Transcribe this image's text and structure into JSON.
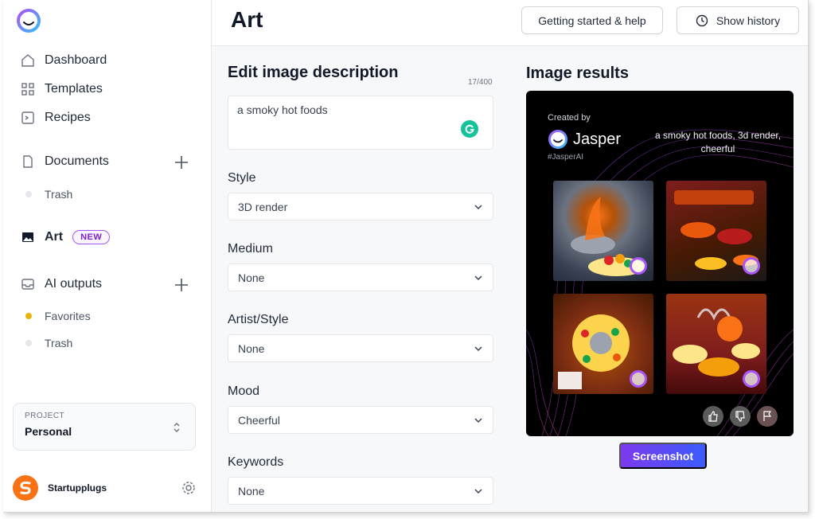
{
  "sidebar": {
    "nav": [
      {
        "label": "Dashboard",
        "icon": "home-icon"
      },
      {
        "label": "Templates",
        "icon": "grid-icon"
      },
      {
        "label": "Recipes",
        "icon": "terminal-icon"
      }
    ],
    "documents": {
      "label": "Documents",
      "items": [
        {
          "label": "Trash"
        }
      ]
    },
    "art": {
      "label": "Art",
      "badge": "NEW"
    },
    "ai_outputs": {
      "label": "AI outputs",
      "items": [
        {
          "label": "Favorites"
        },
        {
          "label": "Trash"
        }
      ]
    },
    "project": {
      "label": "PROJECT",
      "value": "Personal"
    },
    "user": {
      "name": "Startupplugs"
    }
  },
  "header": {
    "title": "Art",
    "help_button": "Getting started & help",
    "history_button": "Show history"
  },
  "editor": {
    "title": "Edit image description",
    "counter": "17/400",
    "description": "a smoky hot foods",
    "fields": [
      {
        "label": "Style",
        "value": "3D render"
      },
      {
        "label": "Medium",
        "value": "None"
      },
      {
        "label": "Artist/Style",
        "value": "None"
      },
      {
        "label": "Mood",
        "value": "Cheerful"
      },
      {
        "label": "Keywords",
        "value": "None"
      }
    ]
  },
  "results": {
    "title": "Image results",
    "created_by": "Created by",
    "brand": "Jasper",
    "hashtag": "#JasperAI",
    "caption": "a smoky hot foods, 3d render, cheerful",
    "screenshot_button": "Screenshot"
  },
  "colors": {
    "accent": "#7c3aed",
    "badge_purple": "#a855f7",
    "favorites_dot": "#eab308",
    "grammarly": "#15c39a"
  }
}
